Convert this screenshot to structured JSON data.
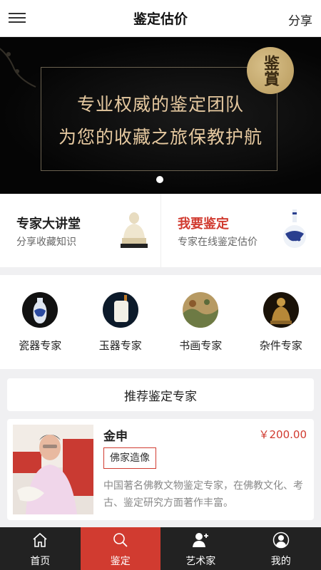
{
  "header": {
    "title": "鉴定估价",
    "share_label": "分享",
    "menu_icon": "hamburger-menu-icon"
  },
  "banner": {
    "line1": "专业权威的鉴定团队",
    "line2": "为您的收藏之旅保教护航",
    "seal_text": "鉴賞",
    "active_slide": 1,
    "slide_count": 1
  },
  "promo": [
    {
      "title": "专家大讲堂",
      "subtitle": "分享收藏知识",
      "image": "jade-buddha-statue"
    },
    {
      "title": "我要鉴定",
      "subtitle": "专家在线鉴定估价",
      "image": "blue-white-porcelain-vase"
    }
  ],
  "categories": [
    {
      "label": "瓷器专家",
      "icon": "porcelain-vase"
    },
    {
      "label": "玉器专家",
      "icon": "jade-pendant"
    },
    {
      "label": "书画专家",
      "icon": "painting-scroll"
    },
    {
      "label": "杂件专家",
      "icon": "bronze-buddha"
    }
  ],
  "recommend": {
    "title": "推荐鉴定专家"
  },
  "experts": [
    {
      "name": "金申",
      "price": "￥200.00",
      "tag": "佛家造像",
      "description": "中国著名佛教文物鉴定专家，在佛教文化、考古、鉴定研究方面著作丰富。",
      "photo": "expert-portrait"
    }
  ],
  "tabbar": [
    {
      "label": "首页",
      "icon": "home-icon",
      "active": false
    },
    {
      "label": "鉴定",
      "icon": "search-icon",
      "active": true
    },
    {
      "label": "艺术家",
      "icon": "add-user-icon",
      "active": false
    },
    {
      "label": "我的",
      "icon": "profile-icon",
      "active": false
    }
  ],
  "colors": {
    "accent": "#d13b30",
    "tabbar_bg": "#222222",
    "banner_text": "#e6c9a0"
  }
}
